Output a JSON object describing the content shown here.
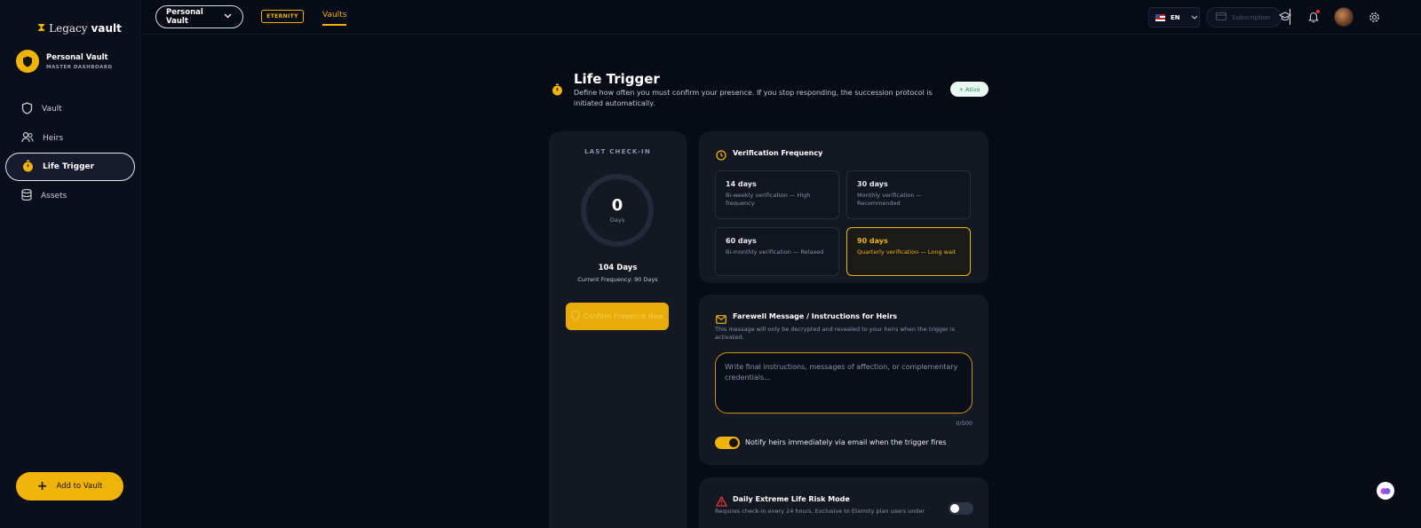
{
  "logo": {
    "part1": "Legacy",
    "part2": "vault"
  },
  "vault_card": {
    "name": "Personal Vault",
    "subtitle": "MASTER DASHBOARD"
  },
  "sidebar": {
    "items": [
      {
        "label": "Vault",
        "icon": "shield-icon"
      },
      {
        "label": "Heirs",
        "icon": "users-icon"
      },
      {
        "label": "Life Trigger",
        "icon": "stopwatch-icon",
        "active": true
      },
      {
        "label": "Assets",
        "icon": "database-icon"
      }
    ],
    "add_button": "Add to Vault"
  },
  "topbar": {
    "vault_select": "Personal Vault",
    "plan_badge": "ETERNITY",
    "tab": "Vaults",
    "language": "EN",
    "subscription": "Subscription"
  },
  "header": {
    "title": "Life Trigger",
    "description": "Define how often you must confirm your presence. If you stop responding, the succession protocol is initiated automatically.",
    "status": "+ Ativo"
  },
  "checkin": {
    "label": "LAST CHECK-IN",
    "value": "0",
    "unit": "Days",
    "total": "104 Days",
    "frequency": "Current Frequency: 90 Days",
    "confirm_button": "Confirm Presence Now"
  },
  "verification": {
    "title": "Verification Frequency",
    "options": [
      {
        "title": "14 days",
        "desc": "Bi-weekly verification — High frequency",
        "selected": false
      },
      {
        "title": "30 days",
        "desc": "Monthly verification — Recommended",
        "selected": false
      },
      {
        "title": "60 days",
        "desc": "Bi-monthly verification — Relaxed",
        "selected": false
      },
      {
        "title": "90 days",
        "desc": "Quarterly verification — Long wait",
        "selected": true
      }
    ]
  },
  "farewell": {
    "title": "Farewell Message / Instructions for Heirs",
    "description": "This message will only be decrypted and revealed to your heirs when the trigger is activated.",
    "placeholder": "Write final instructions, messages of affection, or complementary credentials...",
    "counter": "0/500",
    "notify_label": "Notify heirs immediately via email when the trigger fires",
    "notify_on": true
  },
  "risk": {
    "title": "Daily Extreme Life Risk Mode",
    "description": "Requires check-in every 24 hours. Exclusive to Eternity plan users under",
    "enabled": false
  },
  "colors": {
    "accent": "#f0b30a",
    "background": "#070b16",
    "card": "#131823",
    "danger": "#e53935"
  }
}
